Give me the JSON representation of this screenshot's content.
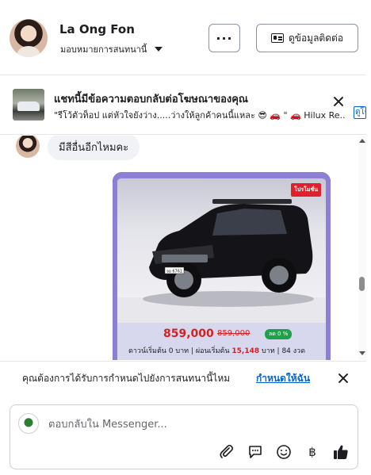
{
  "header": {
    "name": "La Ong Fon",
    "assign_label": "มอบหมายการสนทนานี้",
    "more_label": "···",
    "contact_button_label": "ดูข้อมูลติดต่อ"
  },
  "ad_banner": {
    "title": "แชทนี้มีข้อความตอบกลับต่อโฆษณาของคุณ",
    "subtitle": "\"รีโว้ตัวท็อป แต่หัวใจยังว่าง.....ว่างให้ลูกค้าคนนี้แหละ 😎 🚗 \" 🚗 Hilux Re...",
    "link_label": "ดูโฆษณา"
  },
  "messages": [
    {
      "from": "customer",
      "text": "มีสีอื่นอีกไหมคะ"
    }
  ],
  "ad_card": {
    "tag": "โปรโมชั่น",
    "plate": "จย 6761",
    "price": "859,000",
    "old_price": "859,000",
    "pill": "ลด 0 %",
    "terms_prefix": "ดาวน์เริ่มต้น 0 บาท | ผ่อนเริ่มต้น ",
    "monthly": "15,148",
    "terms_suffix": " บาท | 84 งวด"
  },
  "schedule_prompt": {
    "text": "คุณต้องการได้รับการกำหนดไปยังการสนทนานี้ไหม",
    "link": "กำหนดให้ฉัน"
  },
  "composer": {
    "placeholder": "ตอบกลับใน Messenger..."
  },
  "icons": [
    "more-icon",
    "contact-card-icon",
    "close-icon",
    "attach-icon",
    "chat-bubble-icon",
    "emoji-icon",
    "baht-icon",
    "thumbs-up-icon"
  ],
  "colors": {
    "accent": "#0064d1",
    "like": "#1c1e21"
  }
}
